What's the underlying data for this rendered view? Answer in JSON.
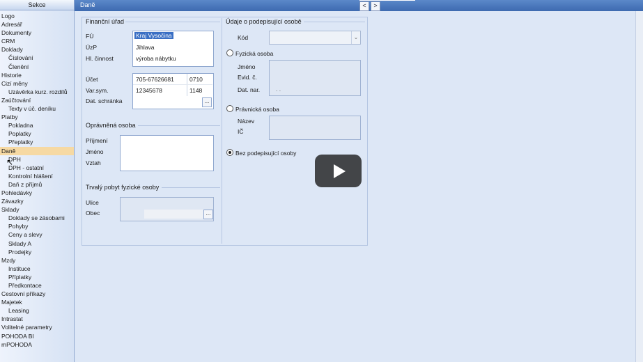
{
  "sidebar": {
    "header": "Sekce",
    "items": [
      {
        "label": "Logo",
        "sub": false
      },
      {
        "label": "Adresář",
        "sub": false
      },
      {
        "label": "Dokumenty",
        "sub": false
      },
      {
        "label": "CRM",
        "sub": false
      },
      {
        "label": "Doklady",
        "sub": false
      },
      {
        "label": "Číslování",
        "sub": true
      },
      {
        "label": "Členění",
        "sub": true
      },
      {
        "label": "Historie",
        "sub": false
      },
      {
        "label": "Cizí měny",
        "sub": false
      },
      {
        "label": "Uzávěrka kurz. rozdílů",
        "sub": true
      },
      {
        "label": "Zaúčtování",
        "sub": false
      },
      {
        "label": "Texty v úč. deníku",
        "sub": true
      },
      {
        "label": "Platby",
        "sub": false
      },
      {
        "label": "Pokladna",
        "sub": true
      },
      {
        "label": "Poplatky",
        "sub": true
      },
      {
        "label": "Přeplatky",
        "sub": true
      },
      {
        "label": "Daně",
        "sub": false,
        "active": true
      },
      {
        "label": "DPH",
        "sub": true
      },
      {
        "label": "DPH - ostatní",
        "sub": true
      },
      {
        "label": "Kontrolní hlášení",
        "sub": true
      },
      {
        "label": "Daň z příjmů",
        "sub": true
      },
      {
        "label": "Pohledávky",
        "sub": false
      },
      {
        "label": "Závazky",
        "sub": false
      },
      {
        "label": "Sklady",
        "sub": false
      },
      {
        "label": "Doklady se zásobami",
        "sub": true
      },
      {
        "label": "Pohyby",
        "sub": true
      },
      {
        "label": "Ceny a slevy",
        "sub": true
      },
      {
        "label": "Sklady A",
        "sub": true
      },
      {
        "label": "Prodejky",
        "sub": true
      },
      {
        "label": "Mzdy",
        "sub": false
      },
      {
        "label": "Instituce",
        "sub": true
      },
      {
        "label": "Příplatky",
        "sub": true
      },
      {
        "label": "Předkontace",
        "sub": true
      },
      {
        "label": "Cestovní příkazy",
        "sub": false
      },
      {
        "label": "Majetek",
        "sub": false
      },
      {
        "label": "Leasing",
        "sub": true
      },
      {
        "label": "Intrastat",
        "sub": false
      },
      {
        "label": "Volitelné parametry",
        "sub": false
      },
      {
        "label": "POHODA BI",
        "sub": false
      },
      {
        "label": "mPOHODA",
        "sub": false
      }
    ]
  },
  "header": {
    "title": "Daně",
    "prev": "<",
    "next": ">"
  },
  "financni_urad": {
    "title": "Finanční úřad",
    "fu_label": "FÚ",
    "fu_value": "Kraj Vysočina",
    "uzp_label": "ÚzP",
    "uzp_value": "Jihlava",
    "cinnost_label": "Hl. činnost",
    "cinnost_value": "výroba nábytku"
  },
  "ucet": {
    "ucet_label": "Účet",
    "ucet_value": "705-67626681",
    "ucet_code": "0710",
    "varsym_label": "Var.sym.",
    "varsym_value": "12345678",
    "varsym_code": "1148",
    "datschranka_label": "Dat. schránka",
    "dots": "..."
  },
  "opravnena_osoba": {
    "title": "Oprávněná osoba",
    "prijmeni_label": "Příjmení",
    "jmeno_label": "Jméno",
    "vztah_label": "Vztah"
  },
  "trvaly_pobyt": {
    "title": "Trvalý pobyt fyzické osoby",
    "ulice_label": "Ulice",
    "obec_label": "Obec",
    "dots": "..."
  },
  "podepisujici": {
    "title": "Údaje o podepisující osobě",
    "kod_label": "Kód",
    "combo_arrow": "⌄",
    "fyzicka_label": "Fyzická osoba",
    "jmeno_label": "Jméno",
    "evid_label": "Evid. č.",
    "datnar_label": "Dat. nar.",
    "datnar_value": ". .",
    "pravnicka_label": "Právnická osoba",
    "nazev_label": "Název",
    "ic_label": "IČ",
    "bez_label": "Bez podepisující osoby",
    "selected": "bez"
  }
}
